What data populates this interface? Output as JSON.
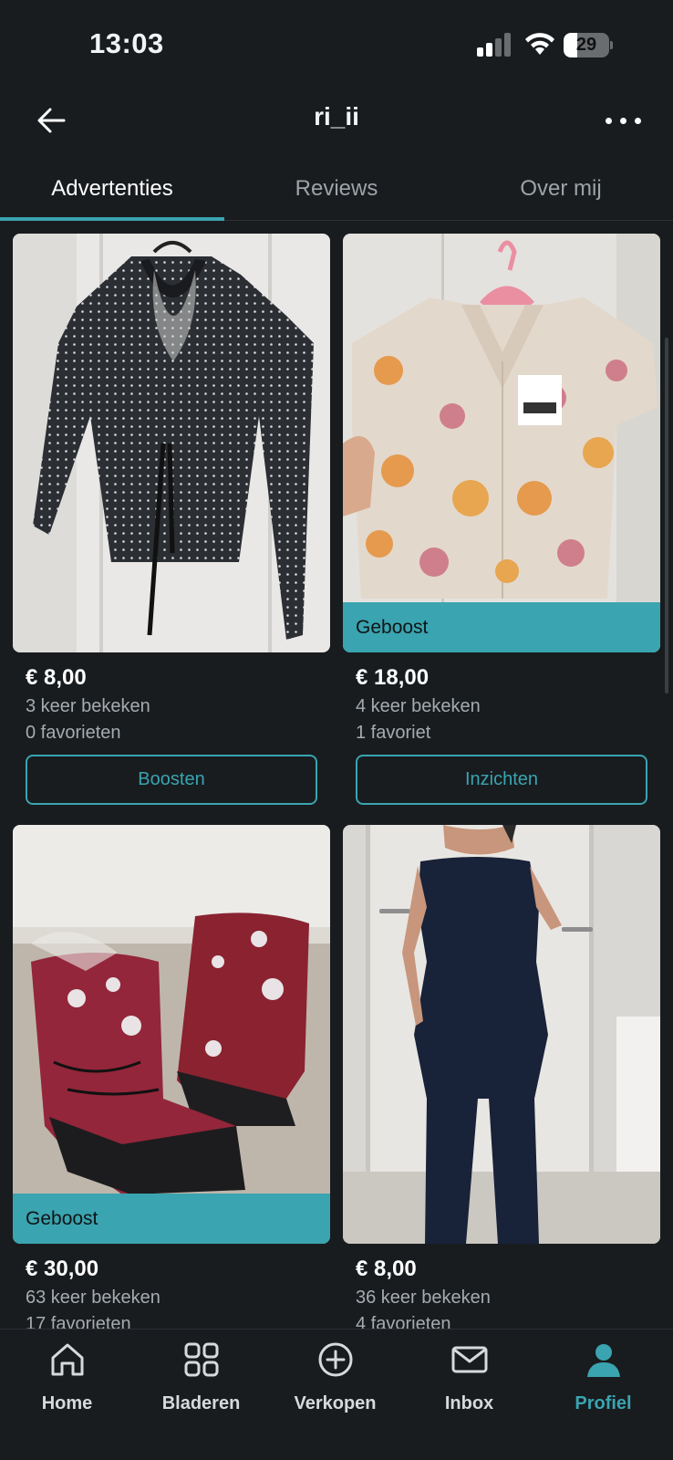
{
  "status_bar": {
    "time": "13:03",
    "battery": "29",
    "battery_level_percent": 29
  },
  "header": {
    "title": "ri_ii",
    "back_icon": "arrow-left-icon",
    "more_icon": "more-horizontal-icon"
  },
  "tabs": [
    {
      "label": "Advertenties",
      "active": true
    },
    {
      "label": "Reviews",
      "active": false
    },
    {
      "label": "Over mij",
      "active": false
    }
  ],
  "listings": [
    {
      "price": "€ 8,00",
      "views": "3 keer bekeken",
      "favorites": "0 favorieten",
      "boost_label": "",
      "action": "Boosten",
      "image": "black-polka-dot-blouse"
    },
    {
      "price": "€ 18,00",
      "views": "4 keer bekeken",
      "favorites": "1 favoriet",
      "boost_label": "Geboost",
      "action": "Inzichten",
      "image": "floral-kids-shirt"
    },
    {
      "price": "€ 30,00",
      "views": "63 keer bekeken",
      "favorites": "17 favorieten",
      "boost_label": "Geboost",
      "action": "",
      "image": "red-paw-snow-boots"
    },
    {
      "price": "€ 8,00",
      "views": "36 keer bekeken",
      "favorites": "4 favorieten",
      "boost_label": "",
      "action": "",
      "image": "navy-jumpsuit"
    }
  ],
  "bottom_nav": [
    {
      "label": "Home",
      "icon": "home-icon"
    },
    {
      "label": "Bladeren",
      "icon": "grid-icon"
    },
    {
      "label": "Verkopen",
      "icon": "plus-circle-icon"
    },
    {
      "label": "Inbox",
      "icon": "mail-icon"
    },
    {
      "label": "Profiel",
      "icon": "profile-icon",
      "active": true
    }
  ],
  "colors": {
    "background": "#181c1f",
    "accent": "#3aa4b0",
    "text_secondary": "#a6abaf"
  }
}
